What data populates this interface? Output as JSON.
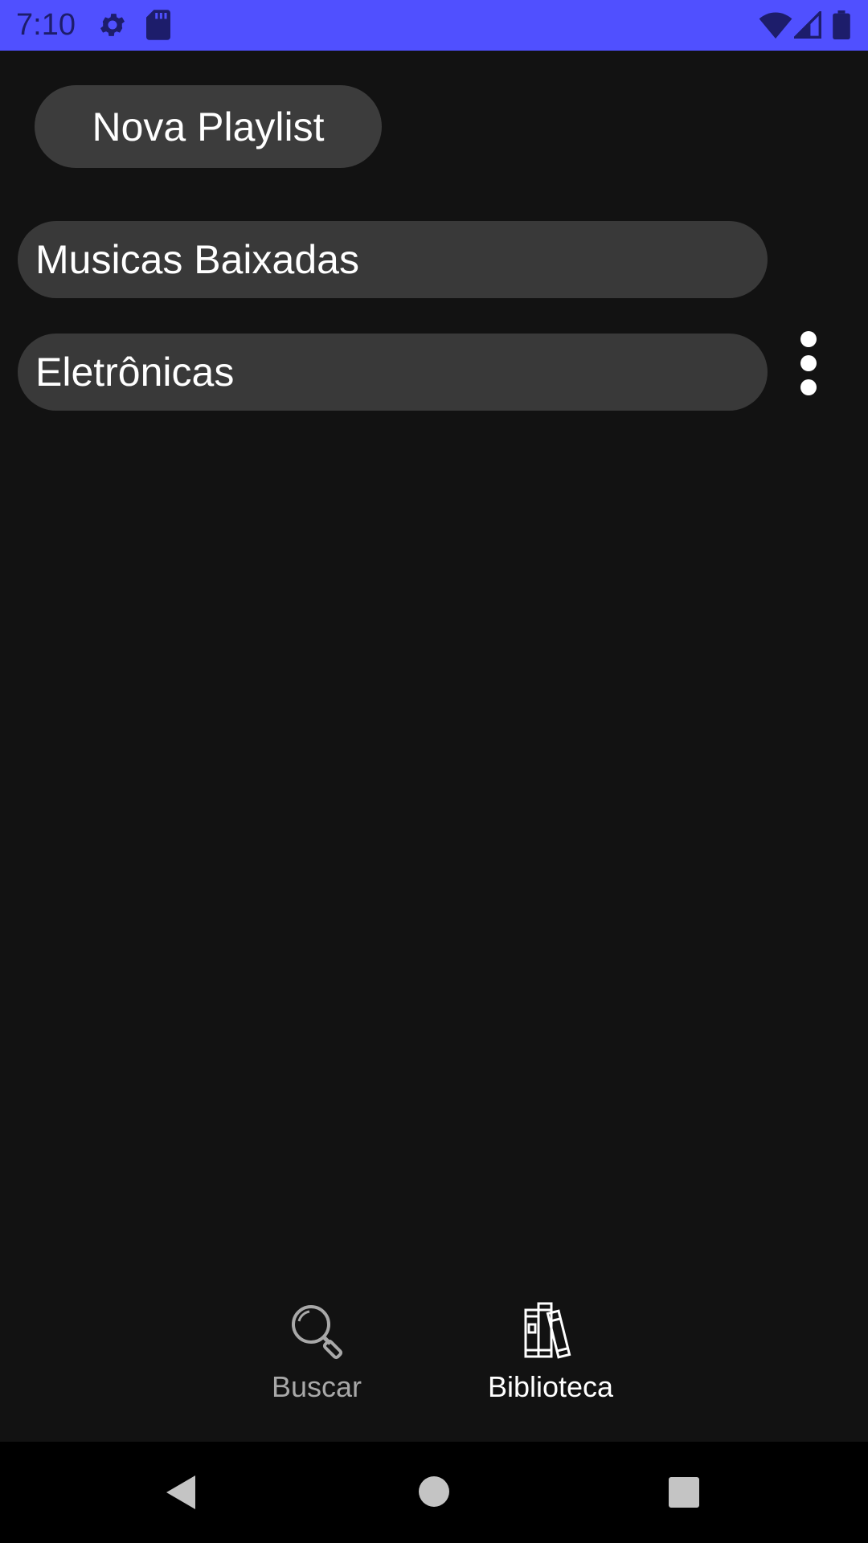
{
  "status_bar": {
    "time": "7:10",
    "icons": [
      "gear-icon",
      "sd-card-icon",
      "wifi-icon",
      "signal-icon",
      "battery-icon"
    ]
  },
  "actions": {
    "new_playlist_label": "Nova Playlist"
  },
  "playlists": [
    {
      "label": "Musicas Baixadas"
    },
    {
      "label": "Eletrônicas"
    }
  ],
  "bottom_nav": {
    "items": [
      {
        "label": "Buscar",
        "icon": "search-icon",
        "active": false
      },
      {
        "label": "Biblioteca",
        "icon": "library-icon",
        "active": true
      }
    ]
  },
  "system_nav": {
    "icons": [
      "back-icon",
      "home-icon",
      "recents-icon"
    ]
  },
  "colors": {
    "status_bar": "#5050ff",
    "background": "#121212",
    "button": "#3c3c3c",
    "playlist_item": "#393939",
    "inactive_text": "#a8a8a8",
    "active_text": "#ffffff"
  }
}
